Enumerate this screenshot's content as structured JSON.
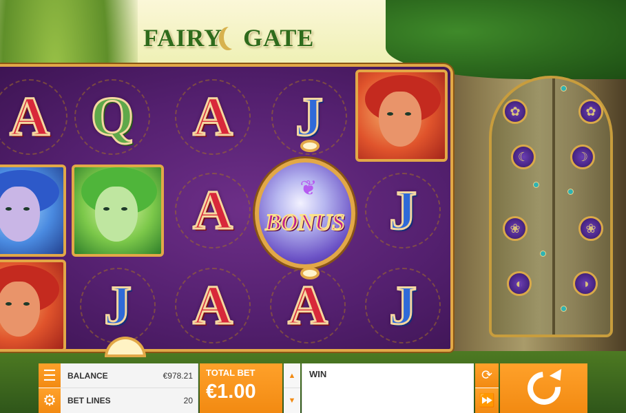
{
  "game": {
    "title": "FAIRY GATE",
    "title_left": "FAIR",
    "title_mid": "Y",
    "title_right": "GATE"
  },
  "reels": {
    "symbols": [
      {
        "id": "r1c1",
        "kind": "letter",
        "value": "A"
      },
      {
        "id": "r1c2",
        "kind": "letter",
        "value": "Q"
      },
      {
        "id": "r1c3",
        "kind": "letter",
        "value": "A"
      },
      {
        "id": "r1c4",
        "kind": "letter",
        "value": "J"
      },
      {
        "id": "r1c5",
        "kind": "fairy",
        "value": "red-fairy"
      },
      {
        "id": "r2c1",
        "kind": "fairy",
        "value": "blue-fairy"
      },
      {
        "id": "r2c2",
        "kind": "fairy",
        "value": "green-fairy"
      },
      {
        "id": "r2c3",
        "kind": "letter",
        "value": "A"
      },
      {
        "id": "r2c4",
        "kind": "bonus",
        "value": "BONUS"
      },
      {
        "id": "r2c5",
        "kind": "letter",
        "value": "J"
      },
      {
        "id": "r3c1",
        "kind": "fairy",
        "value": "red-fairy"
      },
      {
        "id": "r3c2",
        "kind": "letter",
        "value": "J"
      },
      {
        "id": "r3c3",
        "kind": "letter",
        "value": "A"
      },
      {
        "id": "r3c4",
        "kind": "letter",
        "value": "A"
      },
      {
        "id": "r3c5",
        "kind": "letter",
        "value": "J"
      }
    ],
    "bonus_label": "BONUS"
  },
  "controls": {
    "menu_icon": "menu-icon",
    "settings_icon": "gear-icon",
    "balance_label": "BALANCE",
    "balance_value": "€978.21",
    "bet_lines_label": "BET LINES",
    "bet_lines_value": "20",
    "total_bet_label": "TOTAL BET",
    "total_bet_value": "€1.00",
    "win_label": "WIN",
    "autoplay_icon": "autoplay-icon",
    "turbo_icon": "fast-forward-icon",
    "spin_icon": "spin-icon"
  },
  "colors": {
    "accent": "#f28a12",
    "reel_bg": "#54206f",
    "frame_gold": "#e2a847"
  }
}
